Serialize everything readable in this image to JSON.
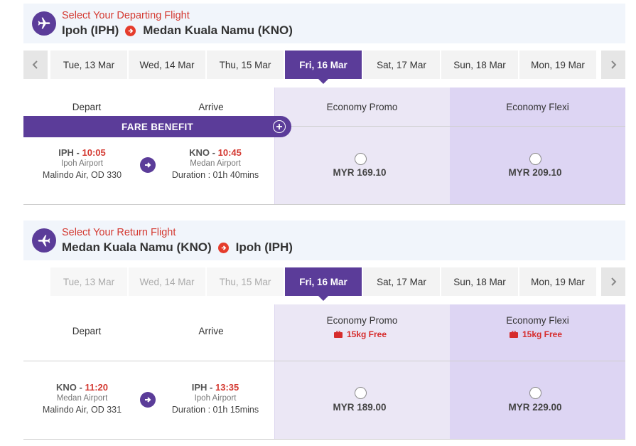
{
  "depart_section": {
    "title": "Select Your Departing Flight",
    "origin": "Ipoh (IPH)",
    "destination": "Medan Kuala Namu (KNO)",
    "dates": [
      "Tue, 13 Mar",
      "Wed, 14 Mar",
      "Thu, 15 Mar",
      "Fri, 16 Mar",
      "Sat, 17 Mar",
      "Sun, 18 Mar",
      "Mon, 19 Mar"
    ],
    "selected_date": "Fri, 16 Mar",
    "columns": {
      "depart": "Depart",
      "arrive": "Arrive",
      "promo": "Economy Promo",
      "flexi": "Economy Flexi"
    },
    "fare_benefit": "FARE BENEFIT",
    "flight": {
      "from_code": "IPH -",
      "from_time": "10:05",
      "from_airport": "Ipoh Airport",
      "carrier": "Malindo Air, OD 330",
      "to_code": "KNO -",
      "to_time": "10:45",
      "to_airport": "Medan Airport",
      "duration": "Duration : 01h 40mins",
      "promo_price": "MYR 169.10",
      "flexi_price": "MYR 209.10"
    }
  },
  "return_section": {
    "title": "Select Your Return Flight",
    "origin": "Medan Kuala Namu (KNO)",
    "destination": "Ipoh (IPH)",
    "dates": [
      "Tue, 13 Mar",
      "Wed, 14 Mar",
      "Thu, 15 Mar",
      "Fri, 16 Mar",
      "Sat, 17 Mar",
      "Sun, 18 Mar",
      "Mon, 19 Mar"
    ],
    "selected_date": "Fri, 16 Mar",
    "columns": {
      "depart": "Depart",
      "arrive": "Arrive",
      "promo": "Economy Promo",
      "flexi": "Economy Flexi"
    },
    "baggage_promo": "15kg Free",
    "baggage_flexi": "15kg Free",
    "flight": {
      "from_code": "KNO -",
      "from_time": "11:20",
      "from_airport": "Medan Airport",
      "carrier": "Malindo Air, OD 331",
      "to_code": "IPH -",
      "to_time": "13:35",
      "to_airport": "Ipoh Airport",
      "duration": "Duration : 01h 15mins",
      "promo_price": "MYR 189.00",
      "flexi_price": "MYR 229.00"
    }
  },
  "colors": {
    "brand_purple": "#5b3c99",
    "accent_red": "#d43a32",
    "promo_bg": "#ebe7f5",
    "flexi_bg": "#ddd5f3"
  },
  "icons": {
    "section": "airplane-icon",
    "route": "arrow-right-circle-icon",
    "prev": "chevron-left-icon",
    "next": "chevron-right-icon",
    "fare_benefit": "plus-circle-icon",
    "flight_arrow": "arrow-right-circle-icon",
    "baggage": "suitcase-icon"
  }
}
